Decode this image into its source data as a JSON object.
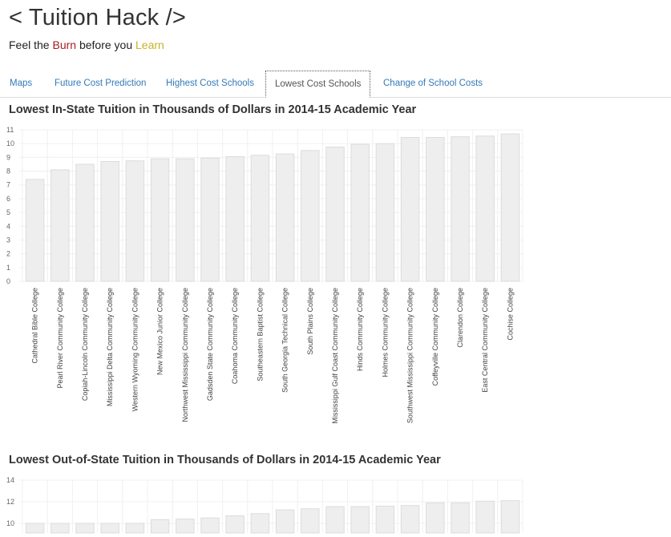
{
  "header": {
    "title": "< Tuition Hack />",
    "tagline_prefix": "Feel the ",
    "tagline_burn": "Burn",
    "tagline_middle": " before you ",
    "tagline_learn": "Learn"
  },
  "tabs": [
    {
      "label": "Maps",
      "active": false
    },
    {
      "label": "Future Cost Prediction",
      "active": false
    },
    {
      "label": "Highest Cost Schools",
      "active": false
    },
    {
      "label": "Lowest Cost Schools",
      "active": true
    },
    {
      "label": "Change of School Costs",
      "active": false
    }
  ],
  "colors": {
    "bar_fill": "#eeeeee",
    "bar_stroke": "#dcdcdc",
    "grid": "#f0f0f0",
    "link": "#337ab7",
    "burn": "#a41e22",
    "learn": "#c9b227"
  },
  "chart_data": [
    {
      "type": "bar",
      "title": "Lowest In-State Tuition in Thousands of Dollars in 2014-15 Academic Year",
      "categories": [
        "Cathedral Bible College",
        "Pearl River Community College",
        "Copiah-Lincoln Community College",
        "Mississippi Delta Community College",
        "Western Wyoming Community College",
        "New Mexico Junior College",
        "Northwest Mississippi Community College",
        "Gadsden State Community College",
        "Coahoma Community College",
        "Southeastern Baptist College",
        "South Georgia Technical College",
        "South Plains College",
        "Mississippi Gulf Coast Community College",
        "Hinds Community College",
        "Holmes Community College",
        "Southwest Mississippi Community College",
        "Coffeyville Community College",
        "Clarendon College",
        "East Central Community College",
        "Cochise College"
      ],
      "values": [
        7.4,
        8.1,
        8.5,
        8.7,
        8.75,
        8.9,
        8.9,
        8.95,
        9.05,
        9.15,
        9.25,
        9.5,
        9.75,
        9.95,
        10.0,
        10.45,
        10.45,
        10.5,
        10.55,
        10.7
      ],
      "yticks": [
        "0",
        "1",
        "2",
        "3",
        "4",
        "5",
        "6",
        "7",
        "8",
        "9",
        "10",
        "11"
      ],
      "ylim": [
        0,
        11
      ],
      "grid": true
    },
    {
      "type": "bar",
      "title": "Lowest Out-of-State Tuition in Thousands of Dollars in 2014-15 Academic Year",
      "values": [
        9.6,
        9.8,
        9.9,
        9.95,
        10.0,
        10.35,
        10.4,
        10.5,
        10.7,
        10.9,
        11.25,
        11.35,
        11.55,
        11.55,
        11.6,
        11.65,
        11.9,
        11.9,
        12.05,
        12.1
      ],
      "yticks": [
        "10",
        "12",
        "14"
      ],
      "ylim": [
        10,
        14
      ],
      "grid": true
    }
  ]
}
